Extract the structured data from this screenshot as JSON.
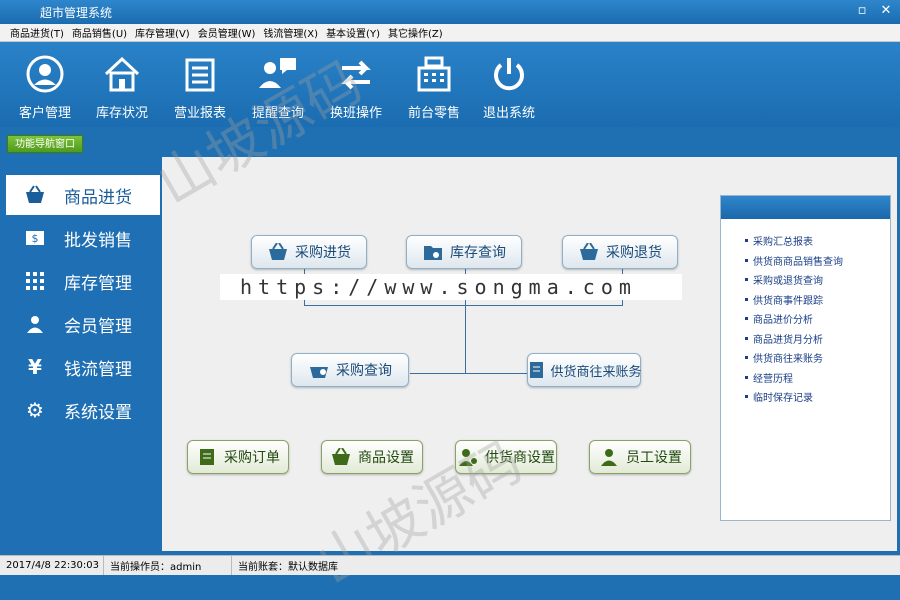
{
  "window": {
    "title": "超市管理系统",
    "minimize": "▫",
    "close": "✕"
  },
  "menu": [
    "商品进货(T)",
    "商品销售(U)",
    "库存管理(V)",
    "会员管理(W)",
    "钱流管理(X)",
    "基本设置(Y)",
    "其它操作(Z)"
  ],
  "toolbar": [
    {
      "label": "客户管理",
      "icon": "user-circle-icon"
    },
    {
      "label": "库存状况",
      "icon": "home-icon"
    },
    {
      "label": "营业报表",
      "icon": "report-icon"
    },
    {
      "label": "提醒查询",
      "icon": "users-chat-icon"
    },
    {
      "label": "换班操作",
      "icon": "swap-icon"
    },
    {
      "label": "前台零售",
      "icon": "cash-register-icon"
    },
    {
      "label": "退出系统",
      "icon": "power-icon"
    }
  ],
  "nav_tag": "功能导航窗口",
  "sidebar": [
    {
      "label": "商品进货",
      "icon": "basket-icon",
      "active": true
    },
    {
      "label": "批发销售",
      "icon": "cash-icon"
    },
    {
      "label": "库存管理",
      "icon": "grid-icon"
    },
    {
      "label": "会员管理",
      "icon": "person-icon"
    },
    {
      "label": "钱流管理",
      "icon": "yen-icon"
    },
    {
      "label": "系统设置",
      "icon": "gear-icon"
    }
  ],
  "flow": {
    "purchase": "采购进货",
    "stock_query": "库存查询",
    "purchase_return": "采购退货",
    "purchase_query": "采购查询",
    "supplier_account": "供货商往来账务"
  },
  "bottom_buttons": [
    "采购订单",
    "商品设置",
    "供货商设置",
    "员工设置"
  ],
  "watermark": "https://www.songma.com",
  "watermark_overlay": "山坡源码",
  "right_links": [
    "采购汇总报表",
    "供货商商品销售查询",
    "采购或退货查询",
    "供货商事件跟踪",
    "商品进价分析",
    "商品进货月分析",
    "供货商往来账务",
    "经营历程",
    "临时保存记录"
  ],
  "status": {
    "datetime": "2017/4/8 22:30:03",
    "operator": "当前操作员：admin",
    "account": "当前账套：默认数据库"
  }
}
